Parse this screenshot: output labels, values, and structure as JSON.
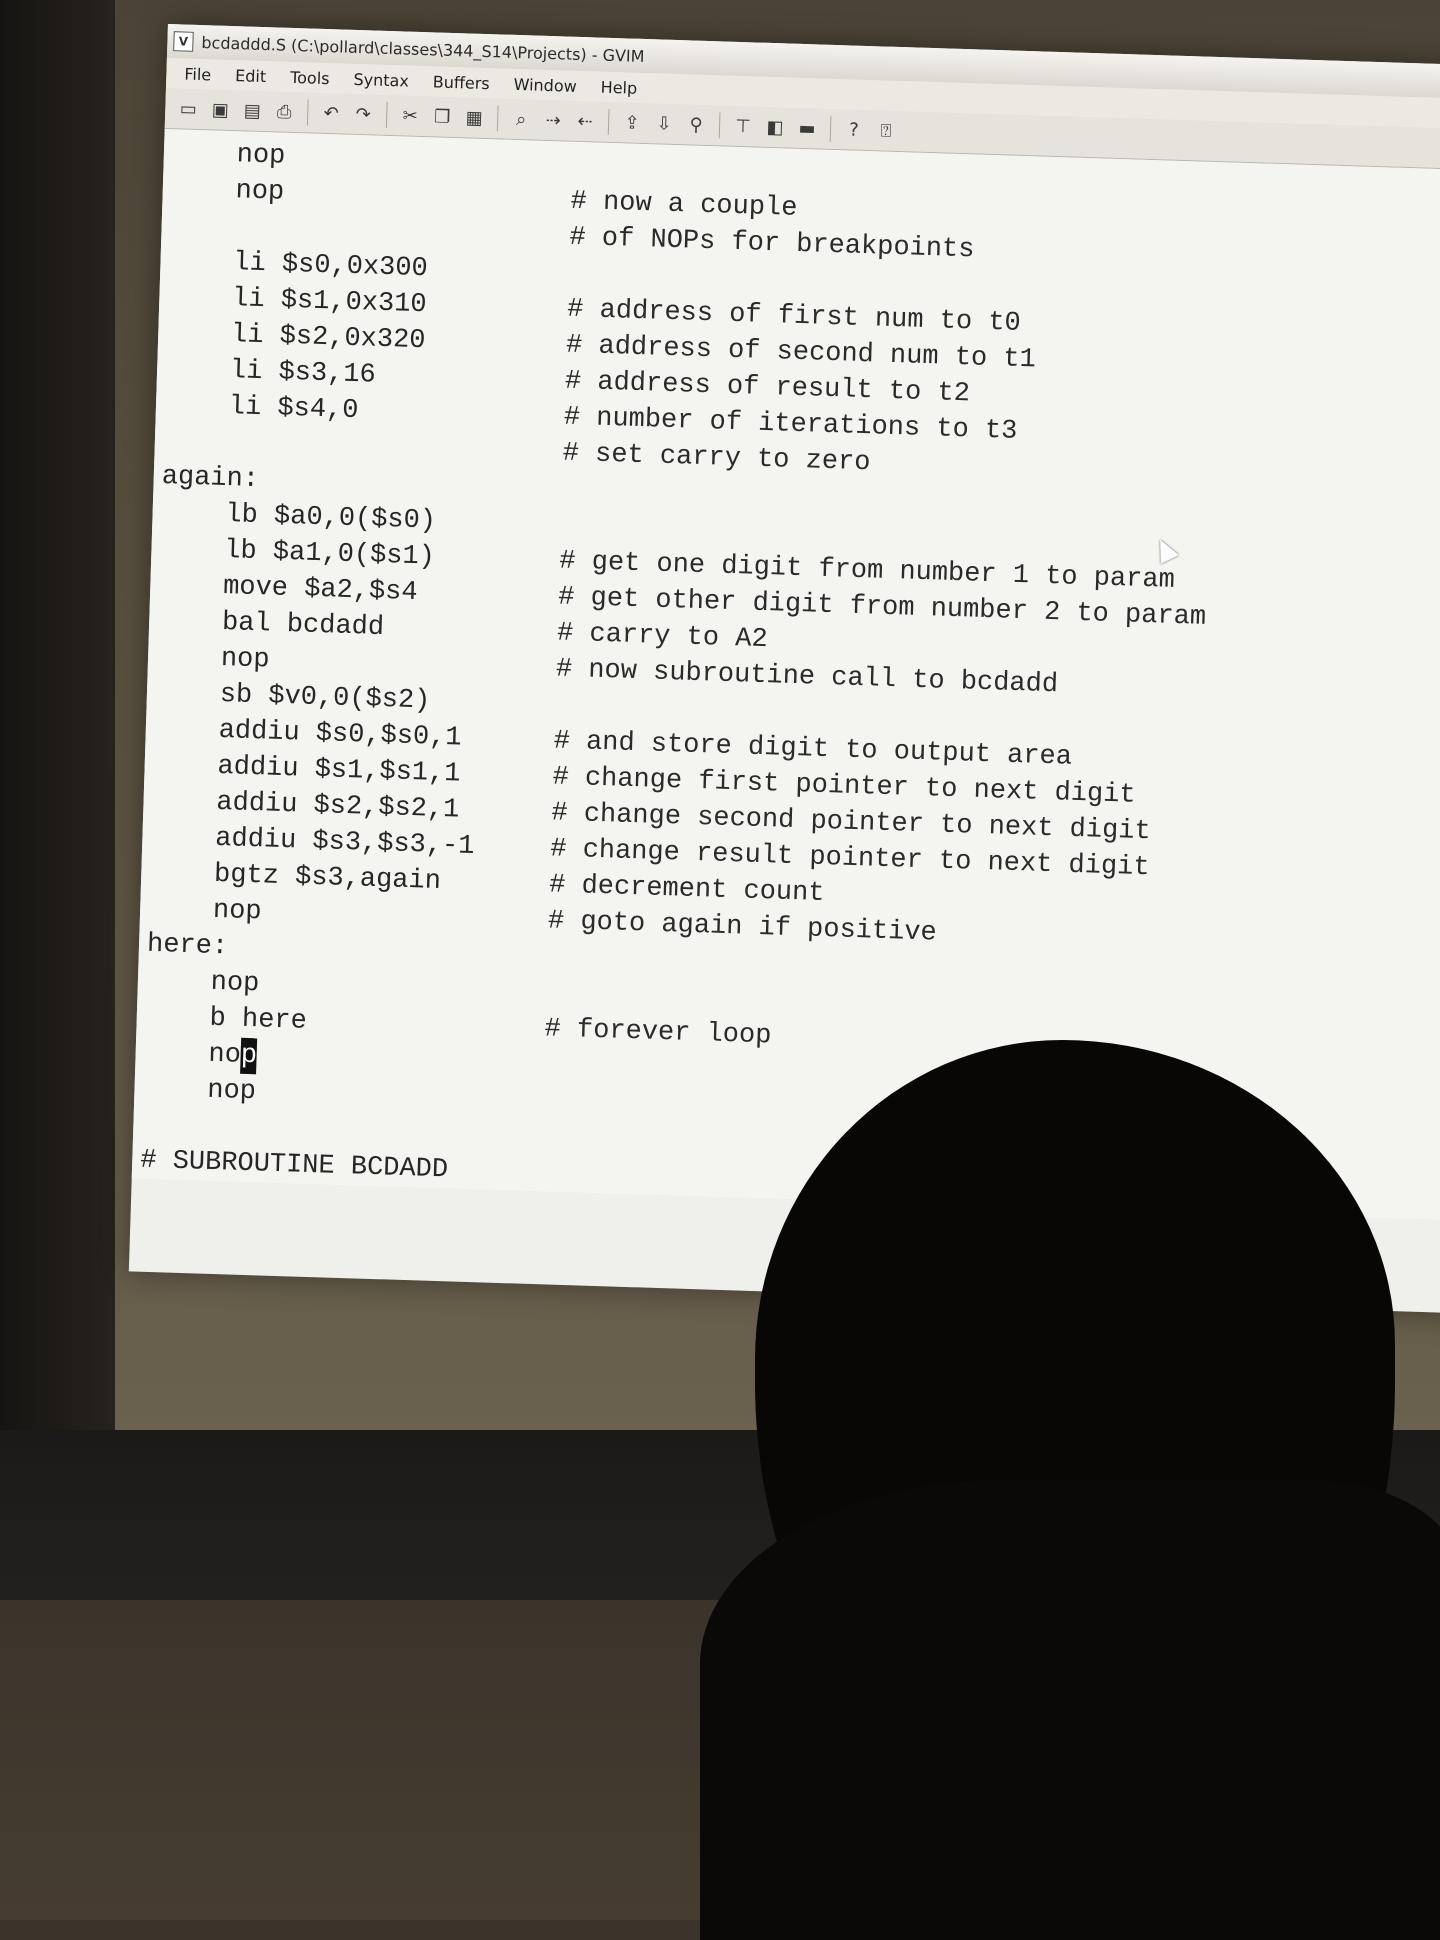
{
  "window": {
    "title": "bcdaddd.S (C:\\pollard\\classes\\344_S14\\Projects) - GVIM"
  },
  "menubar": [
    "File",
    "Edit",
    "Tools",
    "Syntax",
    "Buffers",
    "Window",
    "Help"
  ],
  "toolbar": {
    "icons": [
      "open-icon",
      "save-icon",
      "save-all-icon",
      "print-icon",
      "undo-icon",
      "redo-icon",
      "cut-icon",
      "copy-icon",
      "paste-icon",
      "find-icon",
      "find-next-icon",
      "find-prev-icon",
      "load-session-icon",
      "save-session-icon",
      "run-script-icon",
      "make-icon",
      "shell-icon",
      "ctags-icon",
      "help-icon",
      "find-help-icon"
    ],
    "help_label": "?"
  },
  "editor": {
    "lines": [
      {
        "code": "    nop",
        "comment": ""
      },
      {
        "code": "    nop",
        "comment": "# now a couple"
      },
      {
        "code": "",
        "comment": "# of NOPs for breakpoints"
      },
      {
        "code": "    li $s0,0x300",
        "comment": ""
      },
      {
        "code": "    li $s1,0x310",
        "comment": "# address of first num to t0"
      },
      {
        "code": "    li $s2,0x320",
        "comment": "# address of second num to t1"
      },
      {
        "code": "    li $s3,16",
        "comment": "# address of result to t2"
      },
      {
        "code": "    li $s4,0",
        "comment": "# number of iterations to t3"
      },
      {
        "code": "",
        "comment": "# set carry to zero"
      },
      {
        "code": "again:",
        "comment": ""
      },
      {
        "code": "    lb $a0,0($s0)",
        "comment": ""
      },
      {
        "code": "    lb $a1,0($s1)",
        "comment": "# get one digit from number 1 to param"
      },
      {
        "code": "    move $a2,$s4",
        "comment": "# get other digit from number 2 to param"
      },
      {
        "code": "    bal bcdadd",
        "comment": "# carry to A2"
      },
      {
        "code": "    nop",
        "comment": "# now subroutine call to bcdadd"
      },
      {
        "code": "    sb $v0,0($s2)",
        "comment": ""
      },
      {
        "code": "    addiu $s0,$s0,1",
        "comment": "# and store digit to output area"
      },
      {
        "code": "    addiu $s1,$s1,1",
        "comment": "# change first pointer to next digit"
      },
      {
        "code": "    addiu $s2,$s2,1",
        "comment": "# change second pointer to next digit"
      },
      {
        "code": "    addiu $s3,$s3,-1",
        "comment": "# change result pointer to next digit"
      },
      {
        "code": "    bgtz $s3,again",
        "comment": "# decrement count"
      },
      {
        "code": "    nop",
        "comment": "# goto again if positive"
      },
      {
        "code": "here:",
        "comment": ""
      },
      {
        "code": "    nop",
        "comment": ""
      },
      {
        "code": "    b here",
        "comment": "# forever loop"
      },
      {
        "code": "    no",
        "comment": "",
        "cursor": "p"
      },
      {
        "code": "    nop",
        "comment": ""
      },
      {
        "code": "",
        "comment": ""
      },
      {
        "code": "# SUBROUTINE BCDADD",
        "comment": ""
      }
    ]
  }
}
